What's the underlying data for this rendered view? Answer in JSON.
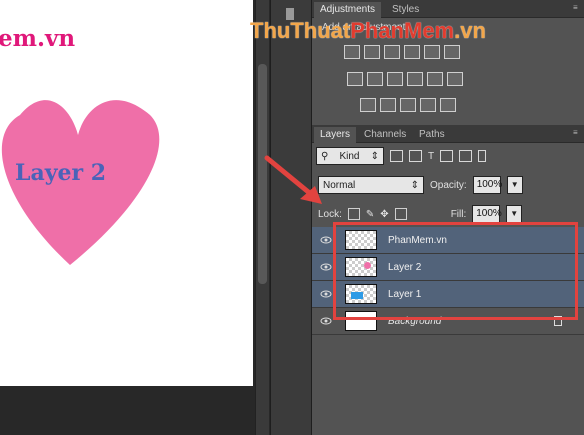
{
  "canvas": {
    "doc_text": "em.vn",
    "heart_label": "Layer 2",
    "colors": {
      "heart": "#ef6fa8",
      "text_pink": "#e0187a",
      "text_blue": "#4a63b8"
    }
  },
  "adjustments_panel": {
    "tabs": [
      "Adjustments",
      "Styles"
    ],
    "title": "Add an adjustment"
  },
  "layers_panel": {
    "tabs": [
      "Layers",
      "Channels",
      "Paths"
    ],
    "filter_kind": "Kind",
    "blend_mode": "Normal",
    "opacity_label": "Opacity:",
    "opacity_value": "100%",
    "lock_label": "Lock:",
    "fill_label": "Fill:",
    "fill_value": "100%",
    "layers": [
      {
        "name": "PhanMem.vn",
        "selected": true,
        "thumb": "transparent"
      },
      {
        "name": "Layer 2",
        "selected": true,
        "thumb": "heart"
      },
      {
        "name": "Layer 1",
        "selected": true,
        "thumb": "blue-shape"
      },
      {
        "name": "Background",
        "selected": false,
        "thumb": "white",
        "locked": true
      }
    ]
  },
  "watermark": {
    "part1": "ThuThuat",
    "part2": "PhanMem",
    "part3": ".vn"
  },
  "annotation": {
    "box_color": "#e2433f",
    "arrow_color": "#e2433f"
  }
}
